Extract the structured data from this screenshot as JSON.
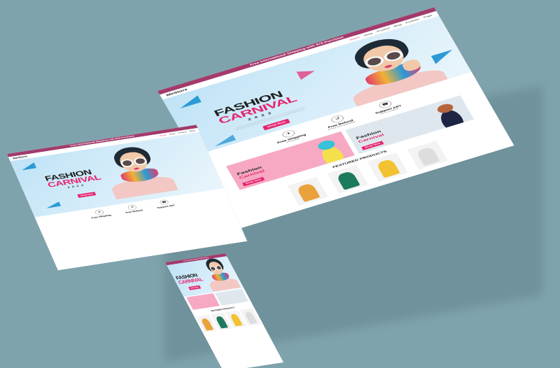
{
  "topbar": {
    "text": "Free International Shipping with $75 Purchase"
  },
  "navbar": {
    "logo": "MeStore",
    "menu": [
      "Home",
      "Shop",
      "Product",
      "Blog",
      "Portfolio",
      "Page"
    ]
  },
  "hero": {
    "title_line1": "FASHION",
    "title_line2": "CARNIVAL",
    "year": "2022",
    "button": "Shop Now"
  },
  "features": [
    {
      "icon": "plane-icon",
      "glyph": "✈",
      "title": "Free Shipping",
      "sub": "Worldwide"
    },
    {
      "icon": "refund-icon",
      "glyph": "↺",
      "title": "Free Refund",
      "sub": "Money back guarantee"
    },
    {
      "icon": "support-icon",
      "glyph": "☎",
      "title": "Support 24/7",
      "sub": "Call us anytime"
    }
  ],
  "banners": [
    {
      "line1": "Fashion",
      "line2": "Carnival",
      "button": "Shop Now"
    },
    {
      "line1": "Fashion",
      "line2": "Carnival",
      "button": "Shop Now"
    }
  ],
  "featured": {
    "title": "FEATURED PRODUCTS"
  },
  "colors": {
    "accent": "#e6246e",
    "topbar": "#a23a6b",
    "background": "#7fa3ad"
  }
}
